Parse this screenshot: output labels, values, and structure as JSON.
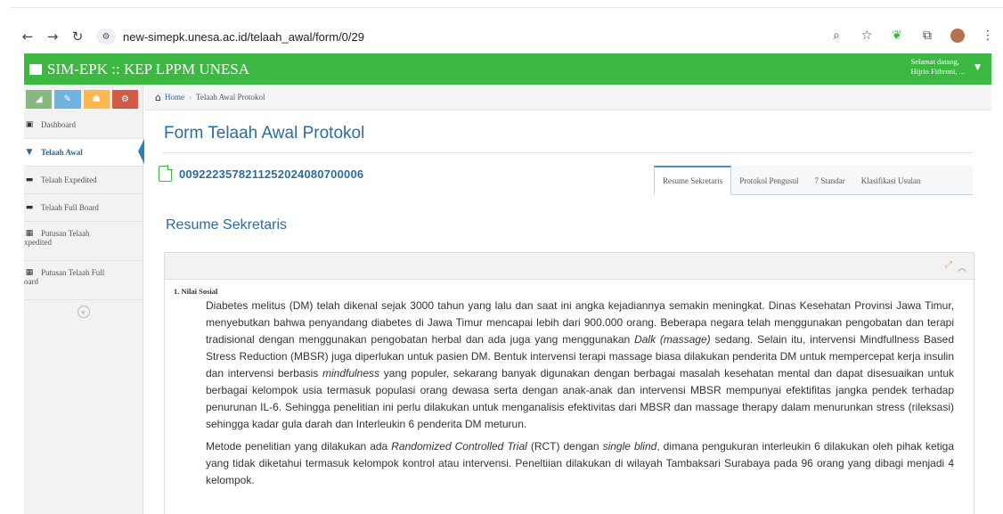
{
  "browser": {
    "url": "new-simepk.unesa.ac.id/telaah_awal/form/0/29"
  },
  "app": {
    "brand": "SIM-EPK :: KEP LPPM UNESA",
    "greeting_line1": "Selamat datang,",
    "greeting_line2": "Hijrin Fithroni, ..."
  },
  "sidebar": {
    "shortcut_colors": [
      "#87b87f",
      "#6fb3e0",
      "#ffb752",
      "#d15b47"
    ],
    "items": [
      {
        "label": "Dashboard",
        "icon": "dashboard-icon"
      },
      {
        "label": "Telaah Awal",
        "icon": "filter-icon"
      },
      {
        "label": "Telaah Expedited",
        "icon": "book-icon"
      },
      {
        "label": "Telaah Full Board",
        "icon": "book-icon"
      },
      {
        "label": "Putusan Telaah",
        "label2": "xpedited",
        "icon": "th-icon"
      },
      {
        "label": "Putusan Telaah Full",
        "label2": "oard",
        "icon": "th-icon"
      }
    ]
  },
  "breadcrumb": {
    "home": "Home",
    "current": "Telaah Awal Protokol"
  },
  "main": {
    "title": "Form Telaah Awal Protokol",
    "doc_number": "0092223578211252024080700006",
    "tabs": [
      "Resume Sekretaris",
      "Protokol Pengusul",
      "7 Standar",
      "Klasifikasi Usulan"
    ],
    "active_tab": 0,
    "section_title": "Resume Sekretaris",
    "question_title": "1. Nilai Sosial",
    "para1_a": "Diabetes melitus (DM) telah dikenal sejak 3000 tahun yang lalu dan saat ini angka kejadiannya semakin meningkat. Dinas Kesehatan Provinsi Jawa Timur, menyebutkan bahwa penyandang diabetes di Jawa Timur mencapai lebih dari 900.000 orang. Beberapa negara telah menggunakan pengobatan dan terapi tradisional dengan menggunakan pengobatan herbal dan ada juga yang menggunakan ",
    "para1_em1": "Dalk (massage)",
    "para1_b": " sedang. Selain itu, intervensi Mindfullness Based Stress Reduction (MBSR) juga diperlukan untuk pasien DM. Bentuk intervensi terapi massage biasa dilakukan penderita DM untuk mempercepat kerja insulin dan intervensi berbasis ",
    "para1_em2": "mindfulness",
    "para1_c": " yang populer, sekarang banyak digunakan dengan berbagai masalah kesehatan mental dan dapat disesuaikan untuk berbagai kelompok usia termasuk populasi orang dewasa serta dengan anak-anak dan intervensi MBSR mempunyai efektifitas jangka pendek terhadap penurunan IL-6. Sehingga penelitian ini perlu dilakukan untuk menganalisis efektivitas dari MBSR dan massage therapy dalam menurunkan stress (rileksasi) sehingga kadar gula darah dan Interleukin 6 penderita DM meturun.",
    "para2_a": "Metode penelitian yang dilakukan ada ",
    "para2_em1": "Randomized Controlled Trial",
    "para2_b": " (RCT) dengan ",
    "para2_em2": "single blind",
    "para2_c": ", dimana pengukuran interleukin 6 dilakukan oleh pihak ketiga yang tidak diketahui termasuk kelompok kontrol atau intervensi. Peneltiian dilakukan di wilayah Tambaksari Surabaya pada 96 orang yang dibagi menjadi 4 kelompok."
  },
  "colors": {
    "header_green": "#3db843",
    "link_blue": "#2b6ca3"
  }
}
